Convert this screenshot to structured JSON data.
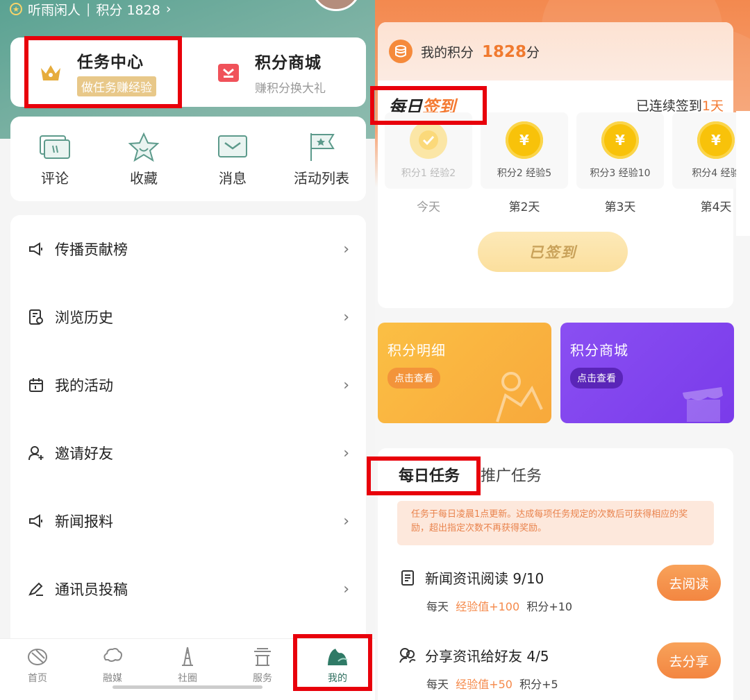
{
  "left": {
    "user": {
      "name": "听雨闲人",
      "divider": "|",
      "points": "积分 1828",
      "arrow": "›"
    },
    "feature_cards": {
      "task_center": {
        "title": "任务中心",
        "subtitle": "做任务赚经验"
      },
      "points_mall": {
        "title": "积分商城",
        "subtitle": "赚积分换大礼"
      }
    },
    "quick_actions": [
      {
        "label": "评论",
        "icon": "comment-icon"
      },
      {
        "label": "收藏",
        "icon": "star-icon"
      },
      {
        "label": "消息",
        "icon": "message-icon"
      },
      {
        "label": "活动列表",
        "icon": "flag-icon"
      }
    ],
    "menu": [
      {
        "label": "传播贡献榜",
        "icon": "megaphone-icon"
      },
      {
        "label": "浏览历史",
        "icon": "history-icon"
      },
      {
        "label": "我的活动",
        "icon": "calendar-icon"
      },
      {
        "label": "邀请好友",
        "icon": "add-user-icon"
      },
      {
        "label": "新闻报料",
        "icon": "megaphone-icon"
      },
      {
        "label": "通讯员投稿",
        "icon": "pen-icon"
      }
    ],
    "chevron": "›",
    "tabs": [
      {
        "label": "首页",
        "icon": "home-icon"
      },
      {
        "label": "融媒",
        "icon": "cloud-icon"
      },
      {
        "label": "社圈",
        "icon": "building-icon"
      },
      {
        "label": "服务",
        "icon": "pavilion-icon"
      },
      {
        "label": "我的",
        "icon": "me-icon",
        "active": true
      }
    ]
  },
  "right": {
    "my_points": {
      "label": "我的积分",
      "value": "1828",
      "unit": "分"
    },
    "signin": {
      "title_a": "每日",
      "title_b": "签到",
      "streak_prefix": "已连续签到",
      "streak_days": "1天",
      "days": [
        {
          "reward": "积分1  经验2",
          "label": "今天",
          "done": true
        },
        {
          "reward": "积分2  经验5",
          "label": "第2天",
          "done": false
        },
        {
          "reward": "积分3  经验10",
          "label": "第3天",
          "done": false
        },
        {
          "reward": "积分4  经验",
          "label": "第4天",
          "done": false
        }
      ],
      "coin_symbol": "¥",
      "button": "已签到"
    },
    "promos": [
      {
        "title": "积分明细",
        "button": "点击查看"
      },
      {
        "title": "积分商城",
        "button": "点击查看"
      }
    ],
    "tasks": {
      "tab_daily": "每日任务",
      "tab_promo": "推广任务",
      "notice": "任务于每日凌晨1点更新。达成每项任务规定的次数后可获得相应的奖励，超出指定次数不再获得奖励。",
      "items": [
        {
          "title": "新闻资讯阅读 9/10",
          "freq": "每天",
          "xp": "经验值+100",
          "points": "积分+10",
          "button": "去阅读"
        },
        {
          "title": "分享资讯给好友 4/5",
          "freq": "每天",
          "xp": "经验值+50",
          "points": "积分+5",
          "button": "去分享"
        }
      ]
    }
  }
}
